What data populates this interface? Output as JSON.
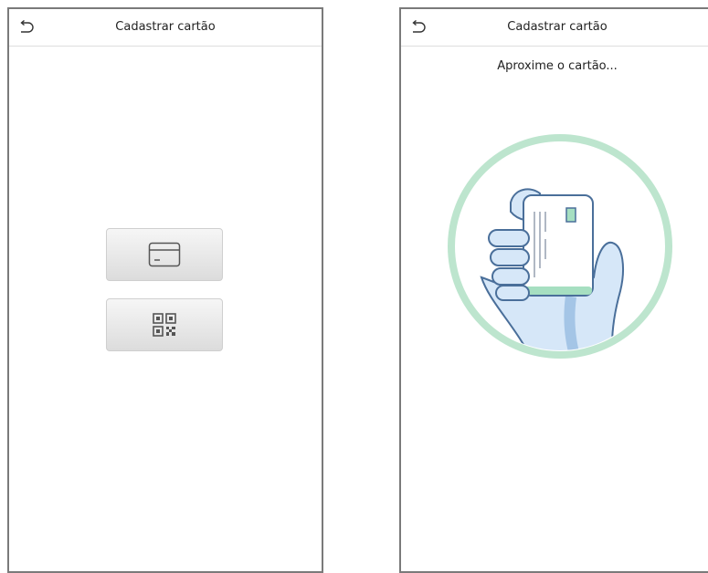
{
  "screen_left": {
    "header": {
      "title": "Cadastrar cartão",
      "back_icon": "back-arrow-icon"
    },
    "options": [
      {
        "icon": "card-icon"
      },
      {
        "icon": "qr-code-icon"
      }
    ]
  },
  "screen_right": {
    "header": {
      "title": "Cadastrar cartão",
      "back_icon": "back-arrow-icon"
    },
    "prompt": "Aproxime o cartão...",
    "illustration": "hand-holding-card-icon"
  },
  "colors": {
    "ring": "#bde5ce",
    "hand_fill": "#d6e7f8",
    "outline": "#4a6f9a",
    "card_accent": "#a6dfc1",
    "border": "#7a7a7a"
  }
}
